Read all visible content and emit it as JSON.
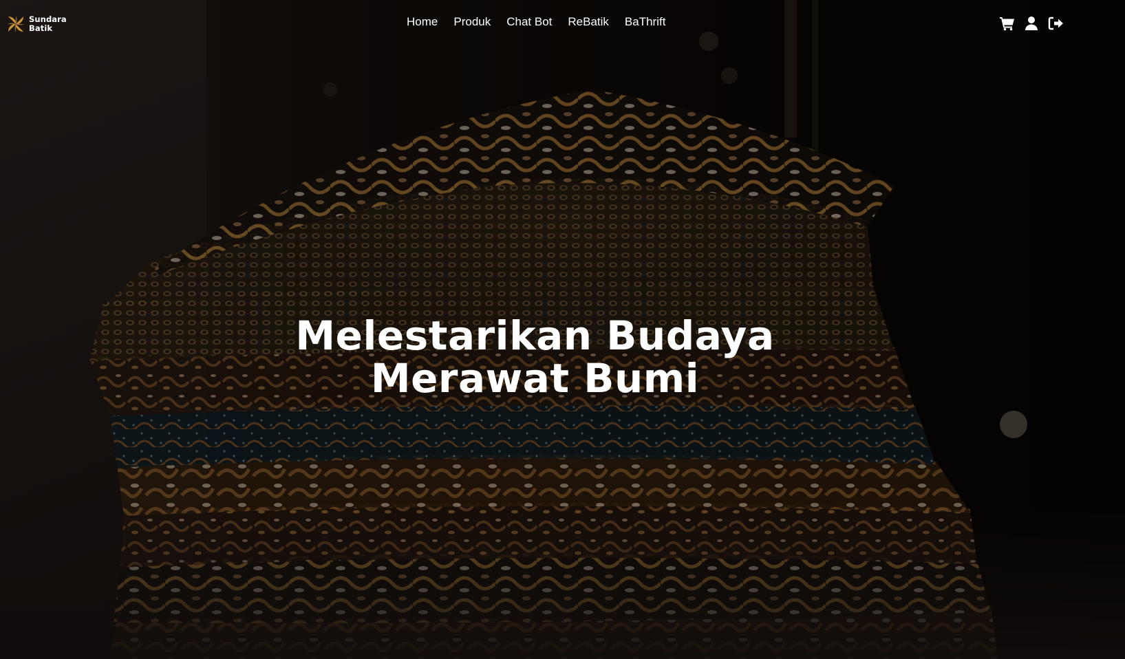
{
  "brand": {
    "name_line1": "Sundara",
    "name_line2": "Batik",
    "accent_color": "#c8923a"
  },
  "nav": {
    "items": [
      {
        "label": "Home"
      },
      {
        "label": "Produk"
      },
      {
        "label": "Chat Bot"
      },
      {
        "label": "ReBatik"
      },
      {
        "label": "BaThrift"
      }
    ],
    "icons": [
      "cart-icon",
      "user-icon",
      "logout-icon"
    ]
  },
  "hero": {
    "headline_line1": "Melestarikan Budaya",
    "headline_line2": "Merawat Bumi",
    "background_image": "stack of folded batik fabrics"
  }
}
